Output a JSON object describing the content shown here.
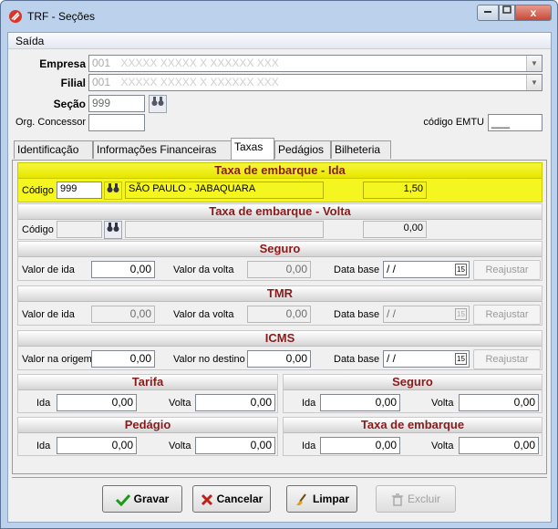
{
  "window": {
    "title": "TRF - Seções",
    "close_glyph": "x"
  },
  "menu": {
    "saida": "Saída"
  },
  "header": {
    "empresa_label": "Empresa",
    "empresa_value": "001",
    "empresa_name": "XXXXX XXXXX X XXXXXX XXX",
    "filial_label": "Filial",
    "filial_value": "001",
    "filial_name": "XXXXX XXXXX X XXXXXX XXX",
    "secao_label": "Seção",
    "secao_value": "999",
    "orgao_label": "Org. Concessor",
    "orgao_value": "",
    "emtu_label": "código EMTU",
    "emtu_value": "___"
  },
  "tabs": [
    "Identificação",
    "Informações Financeiras",
    "Taxas",
    "Pedágios",
    "Bilheteria"
  ],
  "taxas": {
    "ida": {
      "title": "Taxa de embarque - Ida",
      "codigo_label": "Código",
      "codigo": "999",
      "descricao": "SÃO PAULO - JABAQUARA",
      "valor": "1,50"
    },
    "volta": {
      "title": "Taxa de embarque - Volta",
      "codigo_label": "Código",
      "codigo": "",
      "descricao": "",
      "valor": "0,00"
    },
    "seguro": {
      "title": "Seguro",
      "ida_label": "Valor de ida",
      "ida": "0,00",
      "volta_label": "Valor da volta",
      "volta": "0,00",
      "data_label": "Data base",
      "data": " / /",
      "btn": "Reajustar"
    },
    "tmr": {
      "title": "TMR",
      "ida_label": "Valor de ida",
      "ida": "0,00",
      "volta_label": "Valor da volta",
      "volta": "0,00",
      "data_label": "Data base",
      "data": " / /",
      "btn": "Reajustar"
    },
    "icms": {
      "title": "ICMS",
      "ida_label": "Valor na origem",
      "ida": "0,00",
      "volta_label": "Valor no destino",
      "volta": "0,00",
      "data_label": "Data base",
      "data": " / /",
      "btn": "Reajustar"
    },
    "tarifa": {
      "title": "Tarifa",
      "ida_label": "Ida",
      "ida": "0,00",
      "volta_label": "Volta",
      "volta": "0,00"
    },
    "seguro2": {
      "title": "Seguro",
      "ida_label": "Ida",
      "ida": "0,00",
      "volta_label": "Volta",
      "volta": "0,00"
    },
    "pedagio": {
      "title": "Pedágio",
      "ida_label": "Ida",
      "ida": "0,00",
      "volta_label": "Volta",
      "volta": "0,00"
    },
    "taxa_emb": {
      "title": "Taxa de embarque",
      "ida_label": "Ida",
      "ida": "0,00",
      "volta_label": "Volta",
      "volta": "0,00"
    }
  },
  "buttons": {
    "gravar": "Gravar",
    "cancelar": "Cancelar",
    "limpar": "Limpar",
    "excluir": "Excluir"
  },
  "calendar_glyph": "15",
  "colors": {
    "highlight": "#f5f520",
    "section_title": "#8b1a1a"
  }
}
